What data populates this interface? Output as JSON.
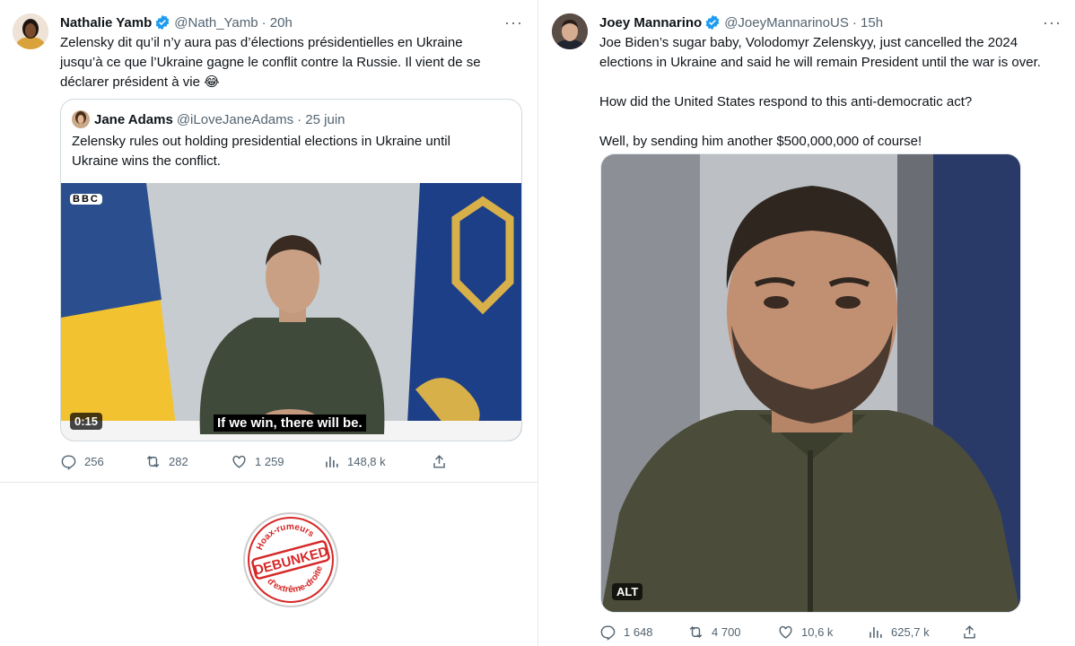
{
  "colors": {
    "text": "#0f1419",
    "muted": "#536471",
    "verified": "#1d9bf0",
    "border": "#cfd9de",
    "stamp": "#d62828"
  },
  "left_tweet": {
    "name": "Nathalie Yamb",
    "handle": "@Nath_Yamb",
    "time": "· 20h",
    "more": "···",
    "text_lines": [
      "Zelensky dit qu’il n’y aura pas d’élections présidentielles en Ukraine",
      "jusqu’à ce que l’Ukraine gagne le conflit contre la Russie. Il vient de se",
      "déclarer président à vie"
    ],
    "emoji": "😂",
    "quote": {
      "name": "Jane Adams",
      "handle": "@iLoveJaneAdams",
      "date": "· 25 juin",
      "text_lines": [
        "Zelensky rules out holding presidential elections in Ukraine until",
        "Ukraine wins the conflict."
      ],
      "video": {
        "broadcaster": "BBC",
        "duration": "0:15",
        "subtitle": "If we win, there will be."
      }
    },
    "stats": {
      "replies": "256",
      "retweets": "282",
      "likes": "1 259",
      "views": "148,8 k"
    }
  },
  "stamp": {
    "top_text": "Hoax-rumeurs",
    "center_text": "DEBUNKED",
    "bottom_text": "d'extrême-droite"
  },
  "right_tweet": {
    "name": "Joey Mannarino",
    "handle": "@JoeyMannarinoUS",
    "time": "· 15h",
    "more": "···",
    "paragraphs": [
      [
        "Joe Biden’s sugar baby, Volodomyr Zelenskyy, just cancelled the 2024",
        "elections in Ukraine and said he will remain President until the war is over."
      ],
      [
        "How did the United States respond to this anti-democratic act?"
      ],
      [
        "Well, by sending him another $500,000,000 of course!"
      ]
    ],
    "image_alt_badge": "ALT",
    "stats": {
      "replies": "1 648",
      "retweets": "4 700",
      "likes": "10,6 k",
      "views": "625,7 k"
    }
  }
}
